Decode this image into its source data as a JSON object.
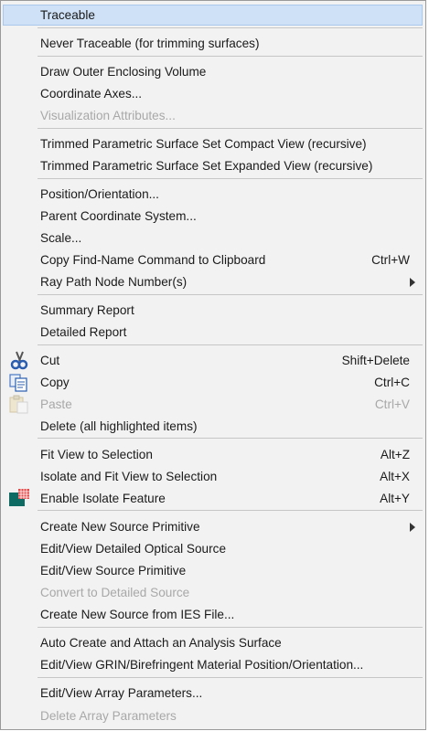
{
  "menu": {
    "items": [
      {
        "label": "Traceable",
        "shortcut": "",
        "state": "highlighted"
      },
      {
        "label": "Never Traceable (for trimming surfaces)",
        "shortcut": ""
      },
      {
        "label": "Draw Outer Enclosing Volume",
        "shortcut": ""
      },
      {
        "label": "Coordinate Axes...",
        "shortcut": ""
      },
      {
        "label": "Visualization Attributes...",
        "shortcut": "",
        "state": "disabled"
      },
      {
        "label": "Trimmed Parametric Surface Set Compact View (recursive)",
        "shortcut": ""
      },
      {
        "label": "Trimmed Parametric Surface Set Expanded View (recursive)",
        "shortcut": ""
      },
      {
        "label": "Position/Orientation...",
        "shortcut": ""
      },
      {
        "label": "Parent Coordinate System...",
        "shortcut": ""
      },
      {
        "label": "Scale...",
        "shortcut": ""
      },
      {
        "label": "Copy Find-Name Command to Clipboard",
        "shortcut": "Ctrl+W"
      },
      {
        "label": "Ray Path Node Number(s)",
        "shortcut": "",
        "submenu": true
      },
      {
        "label": "Summary Report",
        "shortcut": ""
      },
      {
        "label": "Detailed Report",
        "shortcut": ""
      },
      {
        "label": "Cut",
        "shortcut": "Shift+Delete",
        "icon": "scissors-icon"
      },
      {
        "label": "Copy",
        "shortcut": "Ctrl+C",
        "icon": "copy-icon"
      },
      {
        "label": "Paste",
        "shortcut": "Ctrl+V",
        "state": "disabled",
        "icon": "paste-icon"
      },
      {
        "label": "Delete (all highlighted items)",
        "shortcut": ""
      },
      {
        "label": "Fit View to Selection",
        "shortcut": "Alt+Z"
      },
      {
        "label": "Isolate and Fit View to Selection",
        "shortcut": "Alt+X"
      },
      {
        "label": "Enable Isolate Feature",
        "shortcut": "Alt+Y",
        "icon": "isolate-icon"
      },
      {
        "label": "Create New Source Primitive",
        "shortcut": "",
        "submenu": true
      },
      {
        "label": "Edit/View Detailed Optical Source",
        "shortcut": ""
      },
      {
        "label": "Edit/View Source Primitive",
        "shortcut": ""
      },
      {
        "label": "Convert to Detailed Source",
        "shortcut": "",
        "state": "disabled"
      },
      {
        "label": "Create New Source from IES File...",
        "shortcut": ""
      },
      {
        "label": "Auto Create and Attach an Analysis Surface",
        "shortcut": ""
      },
      {
        "label": "Edit/View GRIN/Birefringent Material Position/Orientation...",
        "shortcut": ""
      },
      {
        "label": "Edit/View Array Parameters...",
        "shortcut": ""
      },
      {
        "label": "Delete Array Parameters",
        "shortcut": "",
        "state": "disabled"
      }
    ]
  },
  "colors": {
    "highlight": "#cfe1f7",
    "disabled_text": "#a8a8a8",
    "menu_background": "#f2f2f2"
  }
}
